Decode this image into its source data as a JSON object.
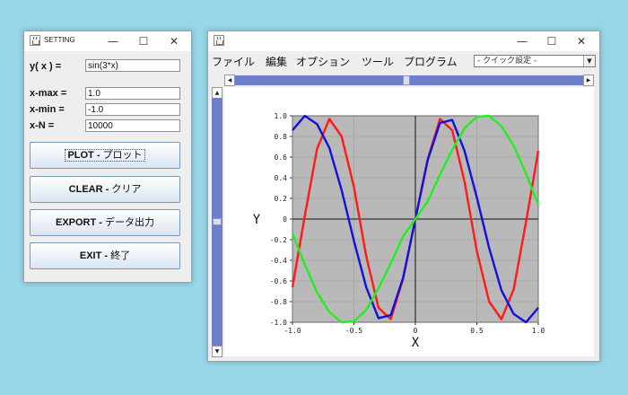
{
  "settings_window": {
    "title": "SETTING",
    "controls": {
      "minimize": "—",
      "maximize": "☐",
      "close": "✕"
    },
    "fields": {
      "function": {
        "label": "y( x ) =",
        "value": "sin(3*x)"
      },
      "xmax": {
        "label": "x-max =",
        "value": "1.0"
      },
      "xmin": {
        "label": "x-min =",
        "value": "-1.0"
      },
      "xn": {
        "label": "x-N =",
        "value": "10000"
      }
    },
    "buttons": {
      "plot": {
        "en": "PLOT - ",
        "jp": "プロット"
      },
      "clear": {
        "en": "CLEAR - ",
        "jp": "クリア"
      },
      "export": {
        "en": "EXPORT - ",
        "jp": "データ出力"
      },
      "exit": {
        "en": "EXIT - ",
        "jp": "終了"
      }
    }
  },
  "plot_window": {
    "title": "",
    "controls": {
      "minimize": "—",
      "maximize": "☐",
      "close": "✕"
    },
    "menu": [
      "ファイル",
      "編集",
      "オプション",
      "ツール",
      "プログラム"
    ],
    "quick_settings": {
      "value": "- クイック設定 -"
    },
    "scroll_arrows": {
      "left": "◀",
      "right": "▶",
      "up": "▲",
      "down": "▼"
    }
  },
  "colors": {
    "plot_bg": "#b9b9b9",
    "red": "#ff1a1a",
    "blue": "#1111dd",
    "green": "#22ee22",
    "scrollbar": "#6d7fc9"
  },
  "chart_data": {
    "type": "line",
    "xlabel": "X",
    "ylabel": "Y",
    "xlim": [
      -1.0,
      1.0
    ],
    "ylim": [
      -1.0,
      1.0
    ],
    "grid": true,
    "x_ticks": [
      "-1.0",
      "-0.5",
      "0",
      "0.5",
      "1.0"
    ],
    "y_ticks": [
      "1.0",
      "0.8",
      "0.6",
      "0.4",
      "0.2",
      "0",
      "-0.2",
      "-0.4",
      "-0.6",
      "-0.8",
      "-1.0"
    ],
    "series": [
      {
        "color": "#ff1a1a",
        "x": [
          -1.0,
          -0.9,
          -0.8,
          -0.7,
          -0.6,
          -0.5,
          -0.4,
          -0.3,
          -0.2,
          -0.1,
          0,
          0.1,
          0.2,
          0.3,
          0.4,
          0.5,
          0.6,
          0.7,
          0.8,
          0.9,
          1.0
        ],
        "y": [
          -0.66,
          0.03,
          0.68,
          0.97,
          0.8,
          0.31,
          -0.36,
          -0.86,
          -0.97,
          -0.58,
          0,
          0.58,
          0.97,
          0.86,
          0.36,
          -0.31,
          -0.8,
          -0.97,
          -0.68,
          -0.03,
          0.66
        ]
      },
      {
        "color": "#1111dd",
        "x": [
          -1.0,
          -0.9,
          -0.8,
          -0.7,
          -0.6,
          -0.5,
          -0.4,
          -0.3,
          -0.2,
          -0.1,
          0,
          0.1,
          0.2,
          0.3,
          0.4,
          0.5,
          0.6,
          0.7,
          0.8,
          0.9,
          1.0
        ],
        "y": [
          0.86,
          1.0,
          0.92,
          0.69,
          0.28,
          -0.21,
          -0.66,
          -0.96,
          -0.93,
          -0.57,
          0,
          0.57,
          0.93,
          0.96,
          0.66,
          0.21,
          -0.28,
          -0.69,
          -0.92,
          -1.0,
          -0.86
        ]
      },
      {
        "color": "#22ee22",
        "x": [
          -1.0,
          -0.9,
          -0.8,
          -0.7,
          -0.6,
          -0.5,
          -0.4,
          -0.3,
          -0.2,
          -0.1,
          0,
          0.1,
          0.2,
          0.3,
          0.4,
          0.5,
          0.6,
          0.7,
          0.8,
          0.9,
          1.0
        ],
        "y": [
          -0.14,
          -0.44,
          -0.71,
          -0.9,
          -1.0,
          -0.99,
          -0.88,
          -0.67,
          -0.43,
          -0.17,
          0,
          0.17,
          0.43,
          0.67,
          0.88,
          0.99,
          1.0,
          0.9,
          0.71,
          0.44,
          0.14
        ]
      }
    ]
  }
}
